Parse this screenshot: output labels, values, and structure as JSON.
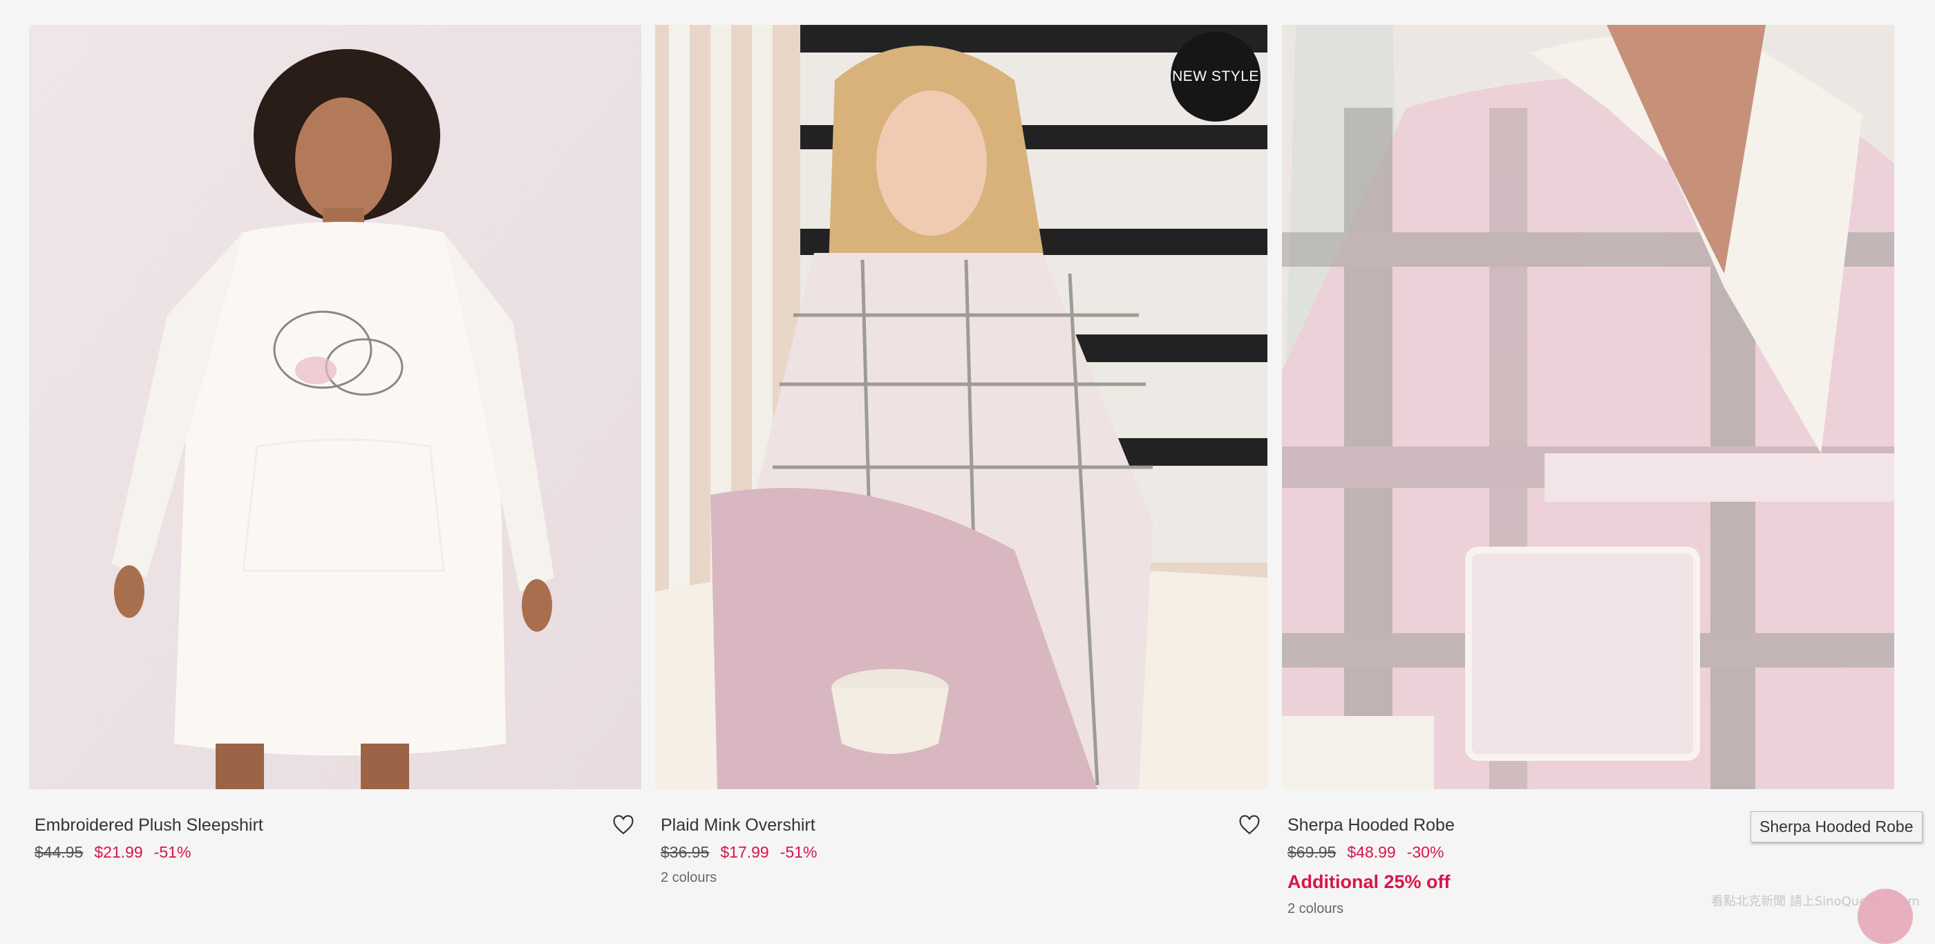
{
  "products": [
    {
      "name": "Embroidered Plush Sleepshirt",
      "old_price": "$44.95",
      "new_price": "$21.99",
      "discount": "-51%",
      "badge": "",
      "promo": "",
      "colours": ""
    },
    {
      "name": "Plaid Mink Overshirt",
      "old_price": "$36.95",
      "new_price": "$17.99",
      "discount": "-51%",
      "badge": "NEW STYLE",
      "promo": "",
      "colours": "2 colours"
    },
    {
      "name": "Sherpa Hooded Robe",
      "old_price": "$69.95",
      "new_price": "$48.99",
      "discount": "-30%",
      "badge": "",
      "promo": "Additional 25% off",
      "colours": "2 colours"
    }
  ],
  "tooltip": "Sherpa Hooded Robe",
  "watermark": "看點北克新聞 請上SinoQuebec.com",
  "colors": {
    "sale": "#d6164a",
    "badge_bg": "#161616",
    "page_bg": "#f5f5f5"
  },
  "icons": [
    "heart-icon"
  ]
}
